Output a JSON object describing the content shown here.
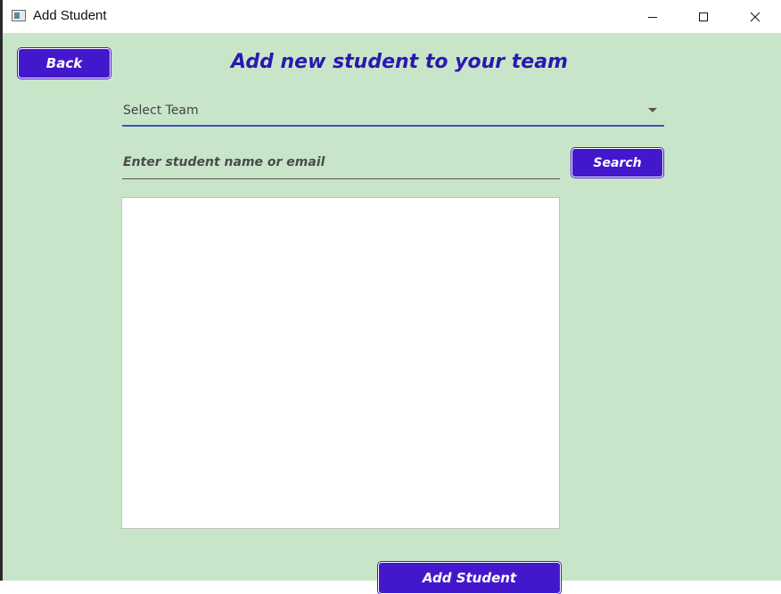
{
  "window": {
    "title": "Add Student",
    "controls": [
      "minimize-icon",
      "maximize-icon",
      "close-icon"
    ]
  },
  "header": {
    "back_label": "Back",
    "title": "Add new student to your team"
  },
  "team_select": {
    "selected": "Select Team"
  },
  "search": {
    "placeholder": "Enter student name or email",
    "value": "",
    "button_label": "Search"
  },
  "results": {
    "items": []
  },
  "footer": {
    "add_label": "Add Student"
  },
  "colors": {
    "background": "#c9e5c9",
    "button": "#4318cc",
    "title": "#2a18b0",
    "select_underline": "#3f51b5"
  }
}
